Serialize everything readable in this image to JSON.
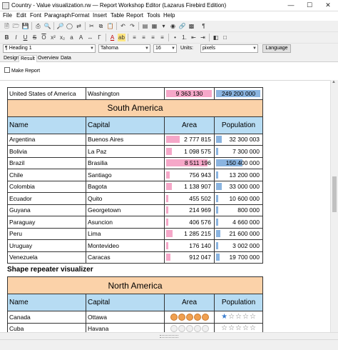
{
  "window": {
    "title": "Country - Value visualization.rw — Report Workshop Editor (Lazarus Firebird Edition)"
  },
  "menu": [
    "File",
    "Edit",
    "Font",
    "Paragraph",
    "Format",
    "Insert",
    "Table",
    "Report",
    "Tools",
    "Help"
  ],
  "format_bar": {
    "style": "Heading 1",
    "font": "Tahoma",
    "size": "16",
    "units_label": "Units:",
    "units": "pixels",
    "language_button": "Language"
  },
  "tabs": [
    "Design",
    "Result",
    "Overview",
    "Data"
  ],
  "active_tab": "Result",
  "make_report": "Make Report",
  "top_row": {
    "name": "United States of America",
    "capital": "Washington",
    "area": "9 363 130",
    "area_fraction": 1.0,
    "population": "249 200 000",
    "pop_fraction": 1.0
  },
  "sa": {
    "region": "South America",
    "headers": {
      "name": "Name",
      "capital": "Capital",
      "area": "Area",
      "population": "Population"
    },
    "rows": [
      {
        "name": "Argentina",
        "capital": "Buenos Aires",
        "area": "2 777 815",
        "area_fraction": 0.3,
        "population": "32 300 003",
        "pop_fraction": 0.13
      },
      {
        "name": "Bolivia",
        "capital": "La Paz",
        "area": "1 098 575",
        "area_fraction": 0.12,
        "population": "7 300 000",
        "pop_fraction": 0.03
      },
      {
        "name": "Brazil",
        "capital": "Brasilia",
        "area": "8 511 196",
        "area_fraction": 0.91,
        "population": "150 400 000",
        "pop_fraction": 0.6
      },
      {
        "name": "Chile",
        "capital": "Santiago",
        "area": "756 943",
        "area_fraction": 0.08,
        "population": "13 200 000",
        "pop_fraction": 0.05
      },
      {
        "name": "Colombia",
        "capital": "Bagota",
        "area": "1 138 907",
        "area_fraction": 0.12,
        "population": "33 000 000",
        "pop_fraction": 0.13
      },
      {
        "name": "Ecuador",
        "capital": "Quito",
        "area": "455 502",
        "area_fraction": 0.05,
        "population": "10 600 000",
        "pop_fraction": 0.04
      },
      {
        "name": "Guyana",
        "capital": "Georgetown",
        "area": "214 969",
        "area_fraction": 0.02,
        "population": "800 000",
        "pop_fraction": 0.0
      },
      {
        "name": "Paraguay",
        "capital": "Asuncion",
        "area": "406 576",
        "area_fraction": 0.04,
        "population": "4 660 000",
        "pop_fraction": 0.02
      },
      {
        "name": "Peru",
        "capital": "Lima",
        "area": "1 285 215",
        "area_fraction": 0.14,
        "population": "21 600 000",
        "pop_fraction": 0.09
      },
      {
        "name": "Uruguay",
        "capital": "Montevideo",
        "area": "176 140",
        "area_fraction": 0.02,
        "population": "3 002 000",
        "pop_fraction": 0.01
      },
      {
        "name": "Venezuela",
        "capital": "Caracas",
        "area": "912 047",
        "area_fraction": 0.1,
        "population": "19 700 000",
        "pop_fraction": 0.08
      }
    ]
  },
  "shape_section_title": "Shape repeater visualizer",
  "na": {
    "region": "North America",
    "headers": {
      "name": "Name",
      "capital": "Capital",
      "area": "Area",
      "population": "Population"
    },
    "rows": [
      {
        "name": "Canada",
        "capital": "Ottawa",
        "area_shapes_on": 5,
        "area_shapes_total": 5,
        "pop_stars_on": 1,
        "pop_stars_total": 5
      },
      {
        "name": "Cuba",
        "capital": "Havana",
        "area_shapes_on": 0,
        "area_shapes_total": 5,
        "pop_stars_on": 0,
        "pop_stars_total": 5
      }
    ]
  },
  "colors": {
    "region_bg": "#fbd2a9",
    "header_bg": "#b7dcf3",
    "area_bar": "#f5a7c8",
    "pop_bar": "#8ab4e0",
    "star_on": "#3c7fd0",
    "shape_on": "#f0a050"
  }
}
